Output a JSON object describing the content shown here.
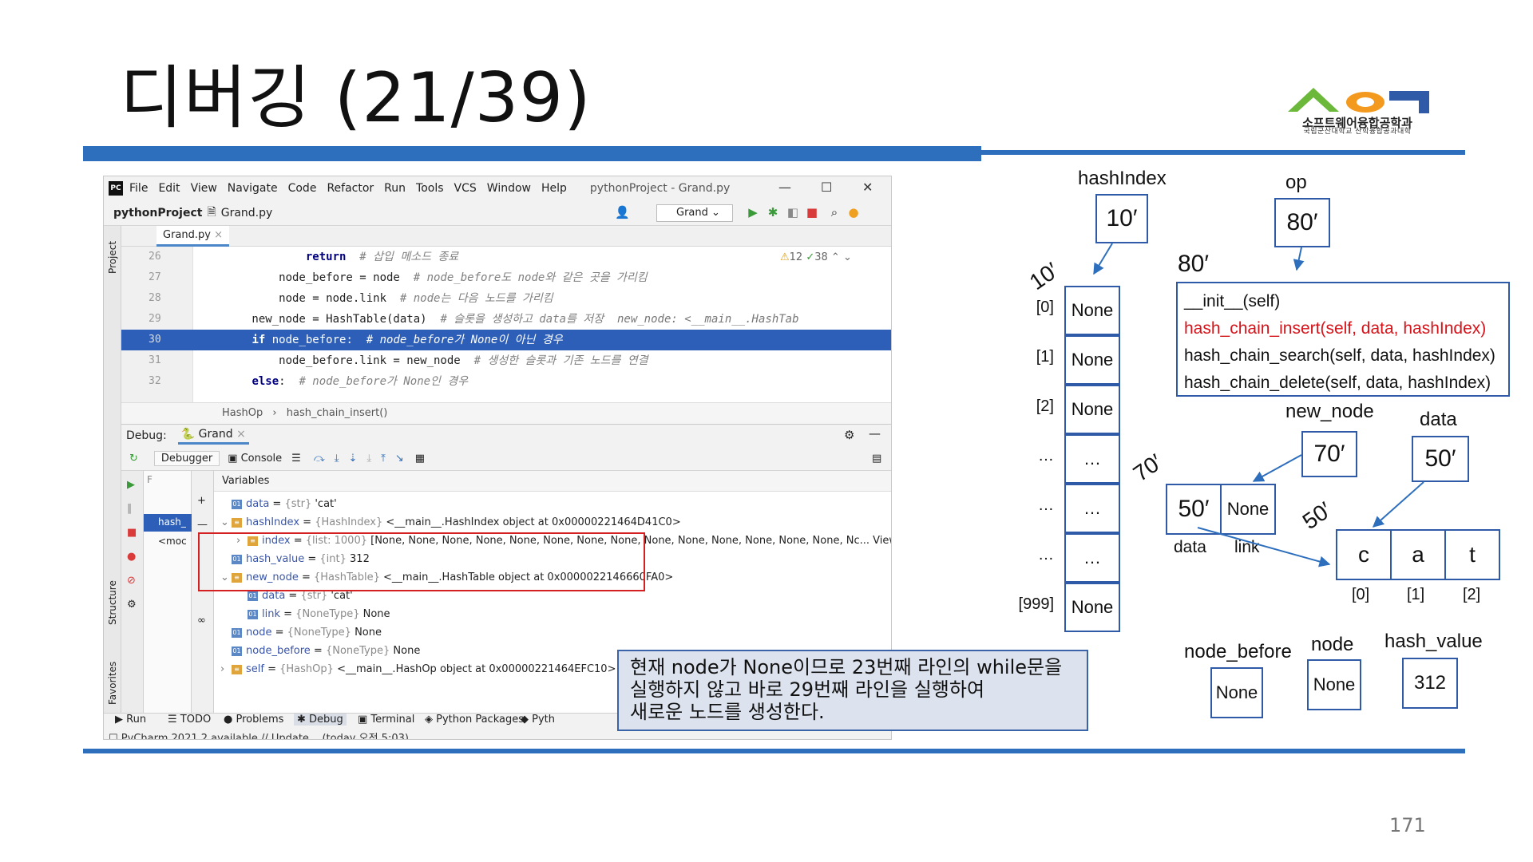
{
  "slide": {
    "title": "디버깅 (21/39)",
    "page_number": "171",
    "logo_text": "소프트웨어융합공학과",
    "logo_subtext": "국립군산대학교 산학융합공과대학"
  },
  "ide": {
    "menu": [
      "File",
      "Edit",
      "View",
      "Navigate",
      "Code",
      "Refactor",
      "Run",
      "Tools",
      "VCS",
      "Window",
      "Help"
    ],
    "window_title": "pythonProject - Grand.py",
    "breadcrumb_project": "pythonProject",
    "breadcrumb_file": "Grand.py",
    "run_config": "Grand",
    "editor_tab": "Grand.py",
    "project_label": "Project",
    "inspection_warn": "12",
    "inspection_ok": "38",
    "code_lines": [
      {
        "no": "26",
        "indent": "                ",
        "kw": "return",
        "rest": "  ",
        "comment": "# 삽입 메소드 종료",
        "inlay": ""
      },
      {
        "no": "27",
        "indent": "            ",
        "kw": "",
        "rest": "node_before = node  ",
        "comment": "# node_before도 node와 같은 곳을 가리킴",
        "inlay": ""
      },
      {
        "no": "28",
        "indent": "            ",
        "kw": "",
        "rest": "node = node.link  ",
        "comment": "# node는 다음 노드를 가리킴",
        "inlay": ""
      },
      {
        "no": "29",
        "indent": "        ",
        "kw": "",
        "rest": "new_node = HashTable(data)  ",
        "comment": "# 슬롯을 생성하고 data를 저장",
        "inlay": "  new_node: <__main__.HashTab"
      },
      {
        "no": "30",
        "indent": "        ",
        "kw": "if",
        "rest": " node_before:  ",
        "comment": "# node_before가 None이 아닌 경우",
        "inlay": ""
      },
      {
        "no": "31",
        "indent": "            ",
        "kw": "",
        "rest": "node_before.link = new_node  ",
        "comment": "# 생성한 슬롯과 기존 노드를 연결",
        "inlay": ""
      },
      {
        "no": "32",
        "indent": "        ",
        "kw": "else",
        "rest": ":  ",
        "comment": "# node_before가 None인 경우",
        "inlay": ""
      }
    ],
    "editor_crumb_1": "HashOp",
    "editor_crumb_2": "hash_chain_insert()",
    "debug_label": "Debug:",
    "debug_config": "Grand",
    "debugger_tab": "Debugger",
    "console_tab": "Console",
    "frames_filter": "F",
    "variables_label": "Variables",
    "frame_1": "hash_",
    "frame_2": "<moc",
    "variables": [
      {
        "indent": 0,
        "expand": "",
        "icon": "01",
        "name": "data",
        "type": "{str}",
        "value": "'cat'"
      },
      {
        "indent": 0,
        "expand": "v",
        "icon": "obj",
        "name": "hashIndex",
        "type": "{HashIndex}",
        "value": "<__main__.HashIndex object at 0x00000221464D41C0>"
      },
      {
        "indent": 1,
        "expand": ">",
        "icon": "list",
        "name": "index",
        "type": "{list: 1000}",
        "value": "[None, None, None, None, None, None, None, None, None, None, None, None, None, None, Nc... View"
      },
      {
        "indent": 0,
        "expand": "",
        "icon": "01",
        "name": "hash_value",
        "type": "{int}",
        "value": "312"
      },
      {
        "indent": 0,
        "expand": "v",
        "icon": "obj",
        "name": "new_node",
        "type": "{HashTable}",
        "value": "<__main__.HashTable object at 0x0000022146660FA0>"
      },
      {
        "indent": 1,
        "expand": "",
        "icon": "01",
        "name": "data",
        "type": "{str}",
        "value": "'cat'"
      },
      {
        "indent": 1,
        "expand": "",
        "icon": "01",
        "name": "link",
        "type": "{NoneType}",
        "value": "None"
      },
      {
        "indent": 0,
        "expand": "",
        "icon": "01",
        "name": "node",
        "type": "{NoneType}",
        "value": "None"
      },
      {
        "indent": 0,
        "expand": "",
        "icon": "01",
        "name": "node_before",
        "type": "{NoneType}",
        "value": "None"
      },
      {
        "indent": 0,
        "expand": ">",
        "icon": "obj",
        "name": "self",
        "type": "{HashOp}",
        "value": "<__main__.HashOp object at 0x00000221464EFC10>"
      }
    ],
    "tool_tabs": [
      "Run",
      "TODO",
      "Problems",
      "Debug",
      "Terminal",
      "Python Packages",
      "Pyth"
    ],
    "status": "PyCharm 2021.2 available // Update... (today 오전 5:03)",
    "structure_label": "Structure",
    "favorites_label": "Favorites"
  },
  "callout": {
    "lines": [
      "현재 node가 None이므로 23번째 라인의 while문을",
      "실행하지 않고 바로 29번째 라인을 실행하여",
      "새로운 노드를 생성한다."
    ]
  },
  "diagram": {
    "hashIndex_label": "hashIndex",
    "hashIndex_value": "10′",
    "op_label": "op",
    "op_value": "80′",
    "addr_10": "10′",
    "addr_80": "80′",
    "addr_70": "70′",
    "addr_50": "50′",
    "slots": [
      {
        "index": "[0]",
        "value": "None"
      },
      {
        "index": "[1]",
        "value": "None"
      },
      {
        "index": "[2]",
        "value": "None"
      },
      {
        "index": "…",
        "value": "…"
      },
      {
        "index": "…",
        "value": "…"
      },
      {
        "index": "…",
        "value": "…"
      },
      {
        "index": "[999]",
        "value": "None"
      }
    ],
    "methods": [
      "__init__(self)",
      "hash_chain_insert(self, data, hashIndex)",
      "hash_chain_search(self, data, hashIndex)",
      "hash_chain_delete(self, data, hashIndex)"
    ],
    "new_node_label": "new_node",
    "new_node_value": "70′",
    "data_label": "data",
    "data_value": "50′",
    "node_data": "50′",
    "node_link": "None",
    "node_data_label": "data",
    "node_link_label": "link",
    "chars": [
      "c",
      "a",
      "t"
    ],
    "char_indices": [
      "[0]",
      "[1]",
      "[2]"
    ],
    "node_before_label": "node_before",
    "node_before_value": "None",
    "node_label": "node",
    "node_value": "None",
    "hash_value_label": "hash_value",
    "hash_value_value": "312"
  }
}
